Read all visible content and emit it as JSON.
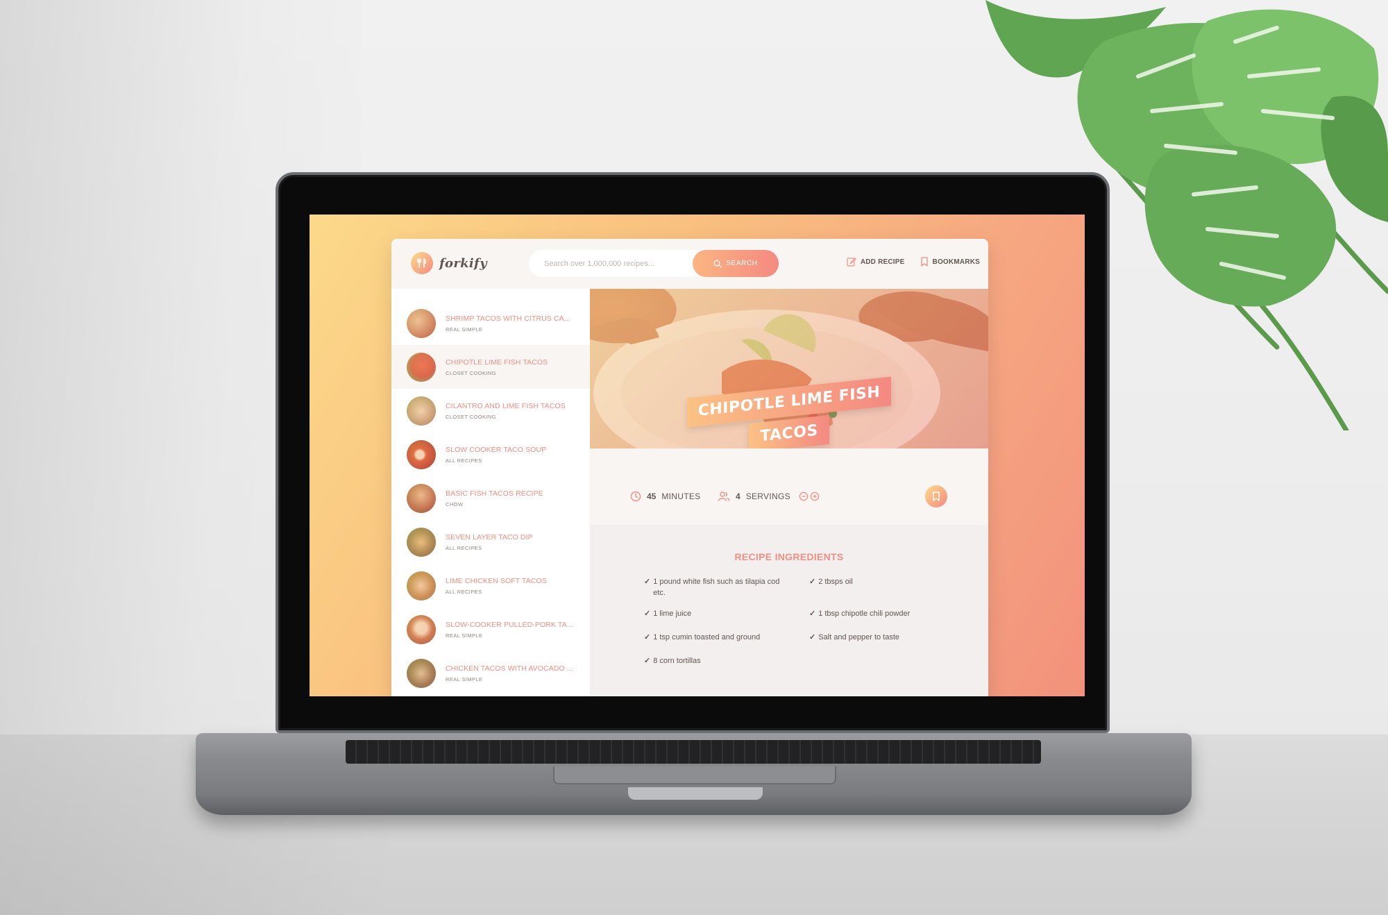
{
  "app": {
    "logo_text": "forkify",
    "search": {
      "placeholder": "Search over 1,000,000 recipes...",
      "button_label": "SEARCH"
    },
    "nav": {
      "add_recipe": "ADD RECIPE",
      "bookmarks": "BOOKMARKS"
    }
  },
  "results": [
    {
      "title": "SHRIMP TACOS WITH CITRUS CA...",
      "publisher": "REAL SIMPLE",
      "active": false
    },
    {
      "title": "CHIPOTLE LIME FISH TACOS",
      "publisher": "CLOSET COOKING",
      "active": true
    },
    {
      "title": "CILANTRO AND LIME FISH TACOS",
      "publisher": "CLOSET COOKING",
      "active": false
    },
    {
      "title": "SLOW COOKER TACO SOUP",
      "publisher": "ALL RECIPES",
      "active": false
    },
    {
      "title": "BASIC FISH TACOS RECIPE",
      "publisher": "CHOW",
      "active": false
    },
    {
      "title": "SEVEN LAYER TACO DIP",
      "publisher": "ALL RECIPES",
      "active": false
    },
    {
      "title": "LIME CHICKEN SOFT TACOS",
      "publisher": "ALL RECIPES",
      "active": false
    },
    {
      "title": "SLOW-COOKER PULLED-PORK TA...",
      "publisher": "REAL SIMPLE",
      "active": false
    },
    {
      "title": "CHICKEN TACOS WITH AVOCADO ...",
      "publisher": "REAL SIMPLE",
      "active": false
    }
  ],
  "recipe": {
    "title_line1": "CHIPOTLE LIME FISH",
    "title_line2": "TACOS",
    "minutes_value": "45",
    "minutes_unit": "MINUTES",
    "servings_value": "4",
    "servings_unit": "SERVINGS",
    "ingredients_heading": "RECIPE INGREDIENTS",
    "ingredients": [
      {
        "qty": "1",
        "text": "pound white fish such as tilapia cod etc."
      },
      {
        "qty": "2",
        "text": "tbsps oil"
      },
      {
        "qty": "1",
        "text": "lime juice"
      },
      {
        "qty": "1",
        "text": "tbsp chipotle chili powder"
      },
      {
        "qty": "1",
        "text": "tsp cumin toasted and ground"
      },
      {
        "qty": "",
        "text": "Salt and pepper to taste"
      },
      {
        "qty": "8",
        "text": "corn tortillas"
      }
    ]
  },
  "colors": {
    "accent_start": "#fbdb89",
    "accent_end": "#f48982",
    "text": "#615551",
    "result_title": "#f38e82"
  },
  "icons": {
    "logo": "fork-knife-icon",
    "search": "search-icon",
    "add_recipe": "edit-icon",
    "bookmarks": "bookmark-icon",
    "minutes": "clock-icon",
    "servings": "users-icon",
    "decrease": "minus-circle-icon",
    "increase": "plus-circle-icon",
    "bookmark_button": "bookmark-icon",
    "check": "check-icon"
  }
}
